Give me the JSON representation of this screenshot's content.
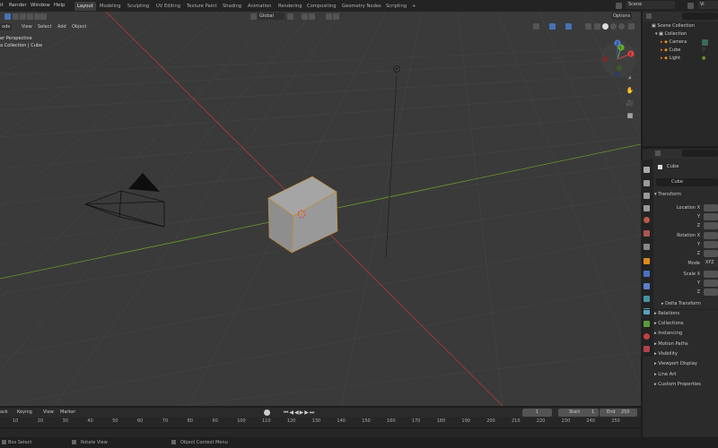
{
  "menu": {
    "items": [
      "it",
      "Render",
      "Window",
      "Help"
    ]
  },
  "workspaces": [
    "Layout",
    "Modeling",
    "Sculpting",
    "UV Editing",
    "Texture Paint",
    "Shading",
    "Animation",
    "Rendering",
    "Compositing",
    "Geometry Nodes",
    "Scripting"
  ],
  "workspace_add": "+",
  "scene": {
    "label": "Scene",
    "viewlayer_stub": "Vi"
  },
  "viewport_header": {
    "mode": "ode",
    "view": "View",
    "select": "Select",
    "add": "Add",
    "object": "Object",
    "orientation": "Global",
    "options": "Options"
  },
  "viewport_overlay": {
    "perspective": "er Perspective",
    "collection": "a Collection | Cube"
  },
  "nav": {
    "zoom": "⌕",
    "pan": "✋",
    "camera": "🎥",
    "grid": "▦"
  },
  "gizmo": {
    "x": "X",
    "y": "Y",
    "z": "Z"
  },
  "outliner": {
    "root": "Scene Collection",
    "collection": "Collection",
    "items": [
      "Camera",
      "Cube",
      "Light"
    ]
  },
  "properties": {
    "object_name": "Cube",
    "object_field": "Cube",
    "transform": "Transform",
    "location_x": "Location X",
    "y": "Y",
    "z": "Z",
    "rotation_x": "Rotation X",
    "mode_label": "Mode",
    "mode_value": "XYZ E",
    "scale_x": "Scale X",
    "delta": "Delta Transform",
    "panels": [
      "Relations",
      "Collections",
      "Instancing",
      "Motion Paths",
      "Visibility",
      "Viewport Display",
      "Line Art",
      "Custom Properties"
    ]
  },
  "timeline": {
    "playback": "ack",
    "keying": "Keying",
    "view": "View",
    "marker": "Marker",
    "current_frame": "1",
    "start_label": "Start",
    "start_value": "1",
    "end_label": "End",
    "end_value": "250",
    "ticks": [
      "10",
      "20",
      "30",
      "40",
      "50",
      "60",
      "70",
      "80",
      "90",
      "100",
      "110",
      "120",
      "130",
      "140",
      "150",
      "160",
      "170",
      "180",
      "190",
      "200",
      "210",
      "220",
      "230",
      "240",
      "250"
    ]
  },
  "status": {
    "box_select": "Box Select",
    "rotate_view": "Rotate View",
    "context_menu": "Object Context Menu"
  },
  "colors": {
    "accent": "#4772b3",
    "x_axis": "#b23a3a",
    "y_axis": "#6a9a2a",
    "orange": "#e0891f"
  }
}
